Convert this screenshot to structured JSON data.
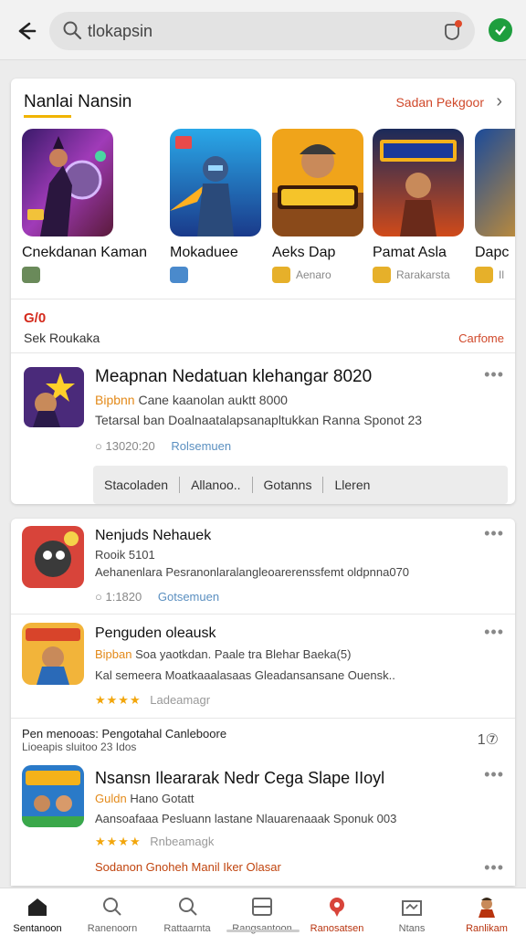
{
  "search": {
    "value": "tlokapsin"
  },
  "colors": {
    "accent": "#d0482a",
    "underline": "#f0b400",
    "star": "#f2a60c",
    "link_blue": "#5a8fc0",
    "avatar_green": "#1e9e3e"
  },
  "section": {
    "title": "Nanlai Nansin",
    "more_label": "Sadan Pekgoor",
    "games": [
      {
        "name": "Cnekdanan Kaman",
        "sub": ""
      },
      {
        "name": "Mokaduee",
        "sub": ""
      },
      {
        "name": "Aeks Dap",
        "sub": "Aenaro"
      },
      {
        "name": "Pamat Asla",
        "sub": "Rarakarsta"
      },
      {
        "name": "Dapc",
        "sub": "Il"
      }
    ]
  },
  "subsection": {
    "badge": "G/0",
    "left": "Sek Roukaka",
    "right": "Carfome"
  },
  "featured": {
    "title": "Meapnan Nedatuan klehangar 8020",
    "line2_accent": "Bipbnn",
    "line2_rest": "Cane kaanolan auktt 8000",
    "line3": "Tetarsal ban Doalnaatalapsanapltukkan Ranna Sponot 23",
    "time": "13020:20",
    "meta_link": "Rolsemuen",
    "tags": [
      "Stacoladen",
      "Allanoo..",
      "Gotanns",
      "Lleren"
    ]
  },
  "list": [
    {
      "title": "Nenjuds Nehauek",
      "line1": "Rooik 5101",
      "line2": "Aehanenlara Pesranonlaralangleoarerenssfemt oldpnna070",
      "time": "1:1820",
      "meta_link": "Gotsemuen"
    },
    {
      "title": "Penguden oleausk",
      "line1_accent": "Bipban",
      "line1_rest": "Soa yaotkdan. Paale tra Blehar Baeka(5)",
      "line2": "Kal semeera Moatkaaalasaas Gleadansansane Ouensk..",
      "stars": "★★★★",
      "stars_label": "Ladeamagr"
    }
  ],
  "mini_header": {
    "line1": "Pen menooas: Pengotahal Canleboore",
    "line2": "Lioeapis sluitoo    23 Idos",
    "count": "1⑦"
  },
  "last": {
    "title": "Nsansn Ileararak Nedr Cega Slape IIoyl",
    "line1_accent": "Guldn",
    "line1_rest": "Hano Gotatt",
    "line2": "Aansoafaaa Pesluann lastane Nlauarenaaak Sponuk 003",
    "stars": "★★★★",
    "stars_label": "Rnbeamagk",
    "warning": "Sodanon Gnoheh Manil Iker Olasar"
  },
  "nav": [
    {
      "label": "Sentanoon"
    },
    {
      "label": "Ranenoorn"
    },
    {
      "label": "Rattaarnta"
    },
    {
      "label": "Rangsantoon"
    },
    {
      "label": "Ranosatsen"
    },
    {
      "label": "Ntans"
    },
    {
      "label": "Ranlikam"
    }
  ]
}
